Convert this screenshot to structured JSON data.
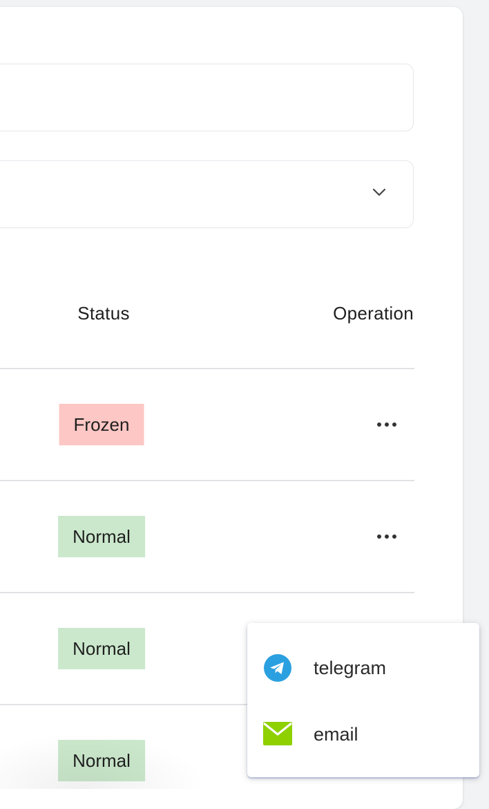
{
  "table": {
    "headers": {
      "status": "Status",
      "operation": "Operation"
    },
    "rows": [
      {
        "status": "Frozen",
        "status_color": "#fcc7c4"
      },
      {
        "status": "Normal",
        "status_color": "#cbe8cc"
      },
      {
        "status": "Normal",
        "status_color": "#cbe8cc"
      },
      {
        "status": "Normal",
        "status_color": "#cbe8cc"
      }
    ]
  },
  "popup_menu": {
    "items": [
      {
        "label": "telegram",
        "icon": "telegram-icon",
        "color": "#2aa0e0"
      },
      {
        "label": "email",
        "icon": "envelope-icon",
        "color": "#8fd000"
      }
    ]
  },
  "form": {
    "select_icon": "chevron-down-icon"
  }
}
